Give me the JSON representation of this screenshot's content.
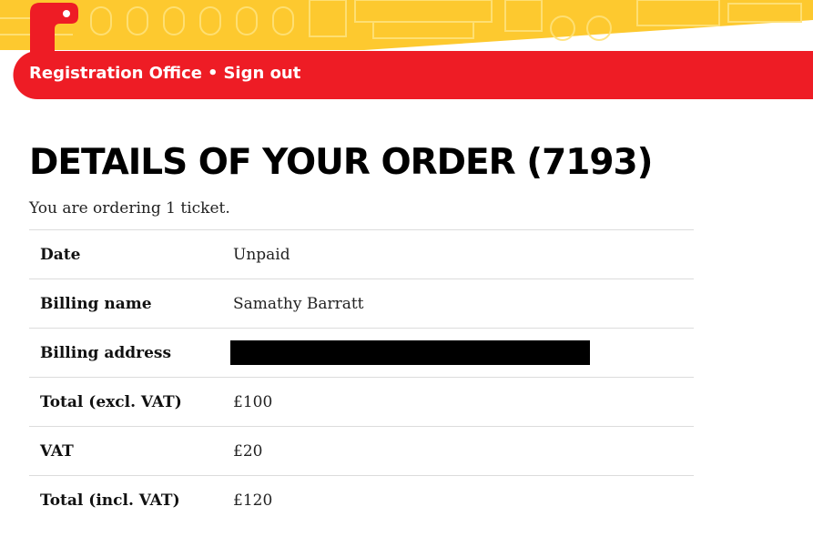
{
  "header": {
    "colors": {
      "yellow": "#fdc92f",
      "red": "#ee1c25"
    },
    "logo_icon": "snake-logo-icon"
  },
  "nav": {
    "registration_office": "Registration Office",
    "separator": "•",
    "sign_out": "Sign out"
  },
  "main": {
    "title": "DETAILS OF YOUR ORDER (7193)",
    "intro": "You are ordering 1 ticket.",
    "rows": [
      {
        "label": "Date",
        "value": "Unpaid"
      },
      {
        "label": "Billing name",
        "value": "Samathy Barratt"
      },
      {
        "label": "Billing address",
        "value": ""
      },
      {
        "label": "Total (excl. VAT)",
        "value": "£100"
      },
      {
        "label": "VAT",
        "value": "£20"
      },
      {
        "label": "Total (incl. VAT)",
        "value": "£120"
      }
    ]
  }
}
